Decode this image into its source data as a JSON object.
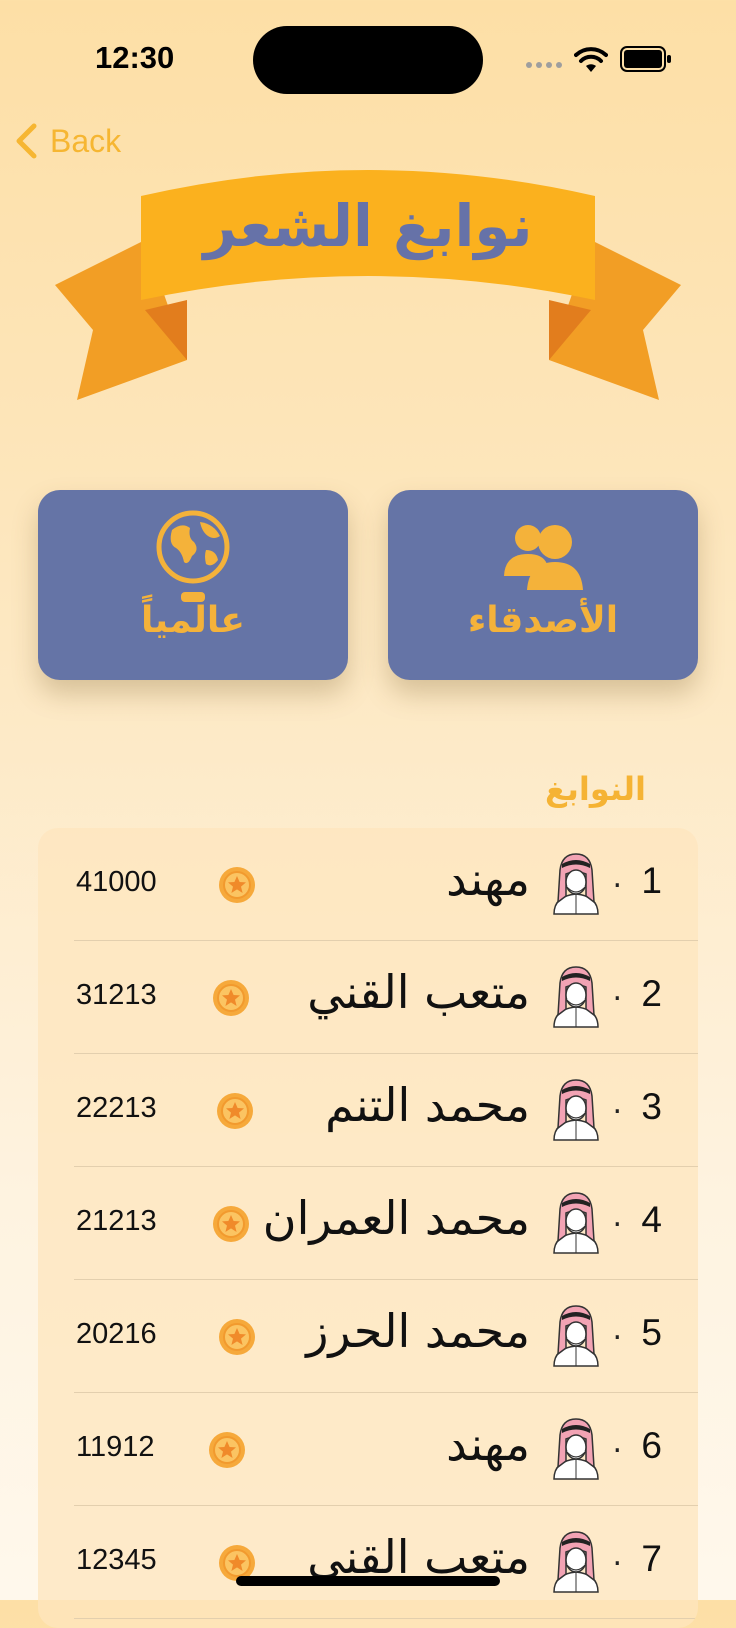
{
  "status_bar": {
    "time": "12:30"
  },
  "nav": {
    "back_label": "Back"
  },
  "banner": {
    "title": "نوابغ الشعر"
  },
  "modes": {
    "friends_label": "الأصدقاء",
    "global_label": "عالمياً"
  },
  "section": {
    "title": "النوابغ"
  },
  "leaderboard": [
    {
      "rank": "1",
      "name": "مهند",
      "score": "41000"
    },
    {
      "rank": "2",
      "name": "متعب القني",
      "score": "31213"
    },
    {
      "rank": "3",
      "name": "محمد التنم",
      "score": "22213"
    },
    {
      "rank": "4",
      "name": "محمد العمران",
      "score": "21213"
    },
    {
      "rank": "5",
      "name": "محمد الحرز",
      "score": "20216"
    },
    {
      "rank": "6",
      "name": "مهند",
      "score": "11912"
    },
    {
      "rank": "7",
      "name": "متعب القني",
      "score": "12345"
    }
  ],
  "colors": {
    "accent": "#F6B632",
    "card": "#6574A6",
    "title": "#6672A8"
  }
}
